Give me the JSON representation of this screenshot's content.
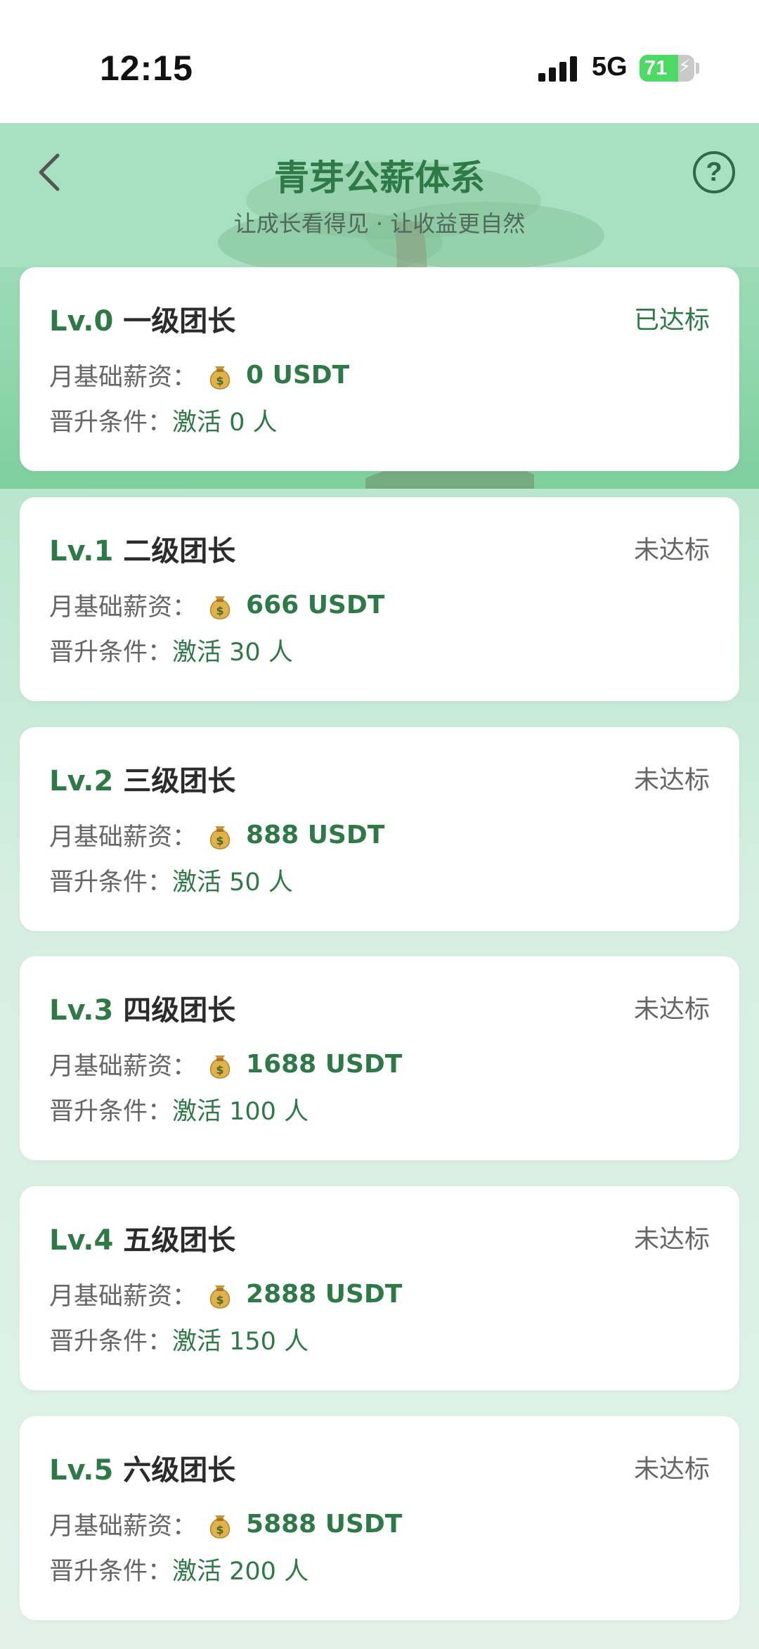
{
  "status_bar": {
    "time": "12:15",
    "network": "5G",
    "battery": "71",
    "battery_level": 0.71
  },
  "header": {
    "title": "青芽公薪体系",
    "subtitle": "让成长看得见 · 让收益更自然",
    "help_label": "?"
  },
  "labels": {
    "salary": "月基础薪资：",
    "condition": "晋升条件："
  },
  "levels": [
    {
      "code": "Lv.0",
      "name": "一级团长",
      "status": "已达标",
      "salary": "0 USDT",
      "condition": "激活 0 人"
    },
    {
      "code": "Lv.1",
      "name": "二级团长",
      "status": "未达标",
      "salary": "666 USDT",
      "condition": "激活 30 人"
    },
    {
      "code": "Lv.2",
      "name": "三级团长",
      "status": "未达标",
      "salary": "888 USDT",
      "condition": "激活 50 人"
    },
    {
      "code": "Lv.3",
      "name": "四级团长",
      "status": "未达标",
      "salary": "1688 USDT",
      "condition": "激活 100 人"
    },
    {
      "code": "Lv.4",
      "name": "五级团长",
      "status": "未达标",
      "salary": "2888 USDT",
      "condition": "激活 150 人"
    },
    {
      "code": "Lv.5",
      "name": "六级团长",
      "status": "未达标",
      "salary": "5888 USDT",
      "condition": "激活 200 人"
    }
  ],
  "colors": {
    "accent": "#2e7a47",
    "header_bg": "#a6e1c1",
    "card_bg": "#ffffff"
  }
}
